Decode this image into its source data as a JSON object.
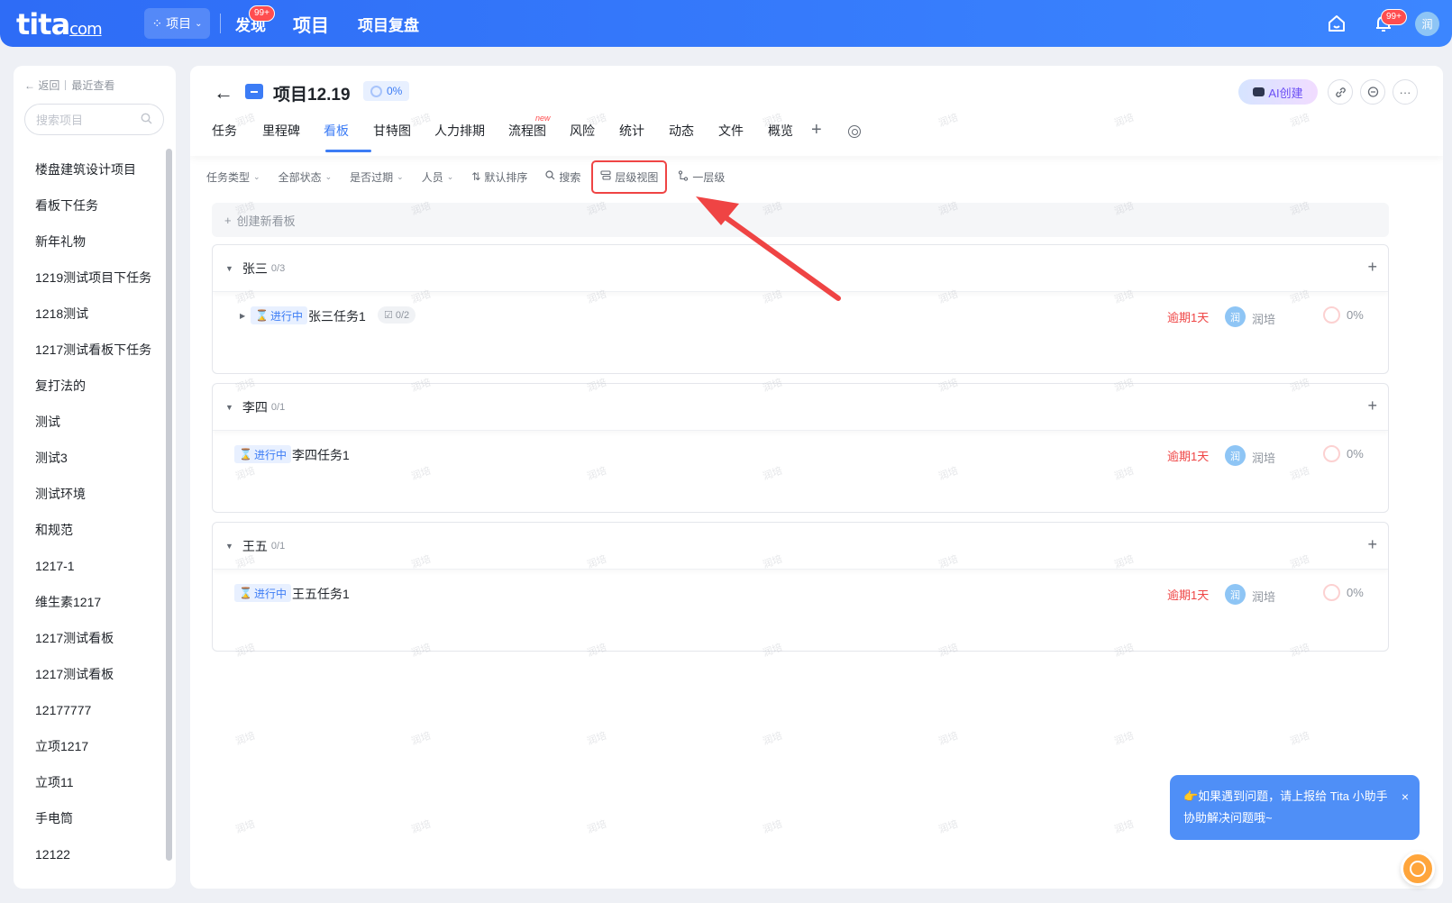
{
  "topbar": {
    "logo": "tita",
    "logo_suffix": "com",
    "project_switch": "项目",
    "nav": [
      {
        "label": "发现",
        "badge": "99+"
      },
      {
        "label": "项目",
        "active": true
      },
      {
        "label": "项目复盘"
      }
    ],
    "notification_badge": "99+",
    "avatar_text": "润"
  },
  "sidebar": {
    "back": "返回",
    "recent": "最近查看",
    "search_placeholder": "搜索项目",
    "projects": [
      "楼盘建筑设计项目",
      "看板下任务",
      "新年礼物",
      "1219测试项目下任务",
      "1218测试",
      "1217测试看板下任务",
      "复打法的",
      "测试",
      "测试3",
      "测试环境",
      "和规范",
      "1217-1",
      "维生素1217",
      "1217测试看板",
      "1217测试看板",
      "12177777",
      "立项1217",
      "立项11",
      "手电筒",
      "12122"
    ]
  },
  "project": {
    "title": "项目12.19",
    "progress": "0%",
    "ai_button": "AI创建",
    "more": "···"
  },
  "tabs": [
    {
      "label": "任务"
    },
    {
      "label": "里程碑"
    },
    {
      "label": "看板",
      "active": true
    },
    {
      "label": "甘特图"
    },
    {
      "label": "人力排期"
    },
    {
      "label": "流程图",
      "tag": "new"
    },
    {
      "label": "风险"
    },
    {
      "label": "统计"
    },
    {
      "label": "动态"
    },
    {
      "label": "文件"
    },
    {
      "label": "概览"
    }
  ],
  "filters": {
    "task_type": "任务类型",
    "all_status": "全部状态",
    "overdue": "是否过期",
    "people": "人员",
    "sort": "默认排序",
    "search": "搜索",
    "hierarchy": "层级视图",
    "level": "一层级"
  },
  "create_board": "创建新看板",
  "groups": [
    {
      "name": "张三",
      "count": "0/3",
      "tasks": [
        {
          "status": "进行中",
          "name": "张三任务1",
          "subtasks": "0/2",
          "overdue": "逾期1天",
          "owner_avatar": "润",
          "owner": "润培",
          "progress": "0%"
        }
      ]
    },
    {
      "name": "李四",
      "count": "0/1",
      "tasks": [
        {
          "status": "进行中",
          "name": "李四任务1",
          "overdue": "逾期1天",
          "owner_avatar": "润",
          "owner": "润培",
          "progress": "0%"
        }
      ]
    },
    {
      "name": "王五",
      "count": "0/1",
      "tasks": [
        {
          "status": "进行中",
          "name": "王五任务1",
          "overdue": "逾期1天",
          "owner_avatar": "润",
          "owner": "润培",
          "progress": "0%"
        }
      ]
    }
  ],
  "watermark": "润培",
  "help": {
    "text": "👉如果遇到问题，请上报给 Tita 小助手协助解决问题哦~",
    "close": "×"
  },
  "colors": {
    "accent": "#3c7cf5",
    "overdue": "#ef4444",
    "annotation": "#ef4444"
  }
}
